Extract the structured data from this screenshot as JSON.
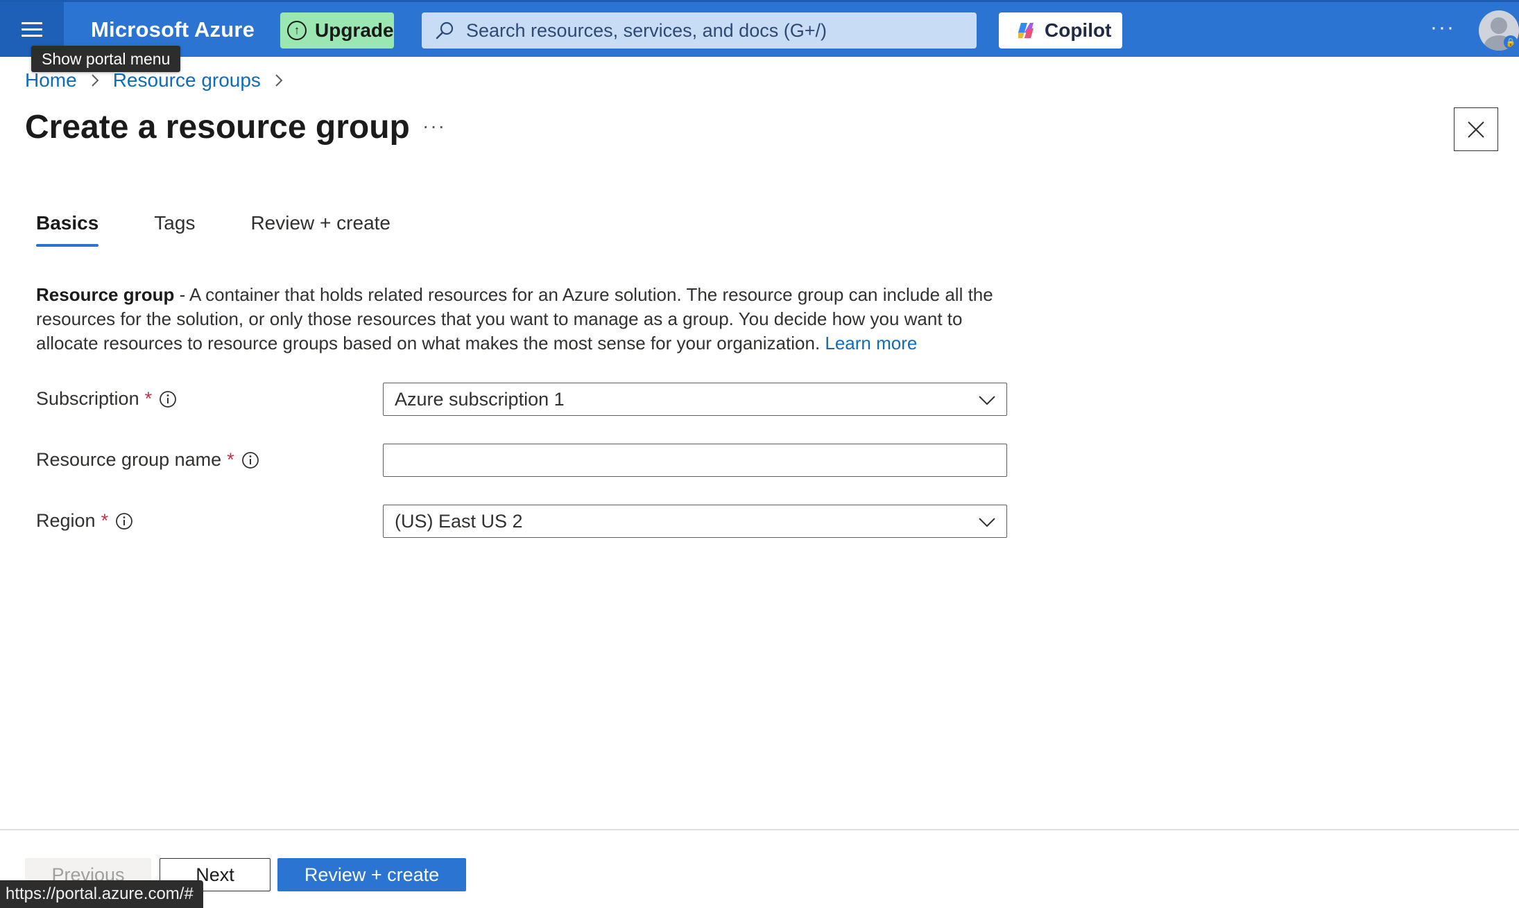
{
  "topbar": {
    "brand": "Microsoft Azure",
    "upgrade_label": "Upgrade",
    "search_placeholder": "Search resources, services, and docs (G+/)",
    "copilot_label": "Copilot",
    "more_label": "···"
  },
  "tooltip": {
    "text": "Show portal menu"
  },
  "breadcrumb": {
    "items": [
      {
        "label": "Home"
      },
      {
        "label": "Resource groups"
      }
    ]
  },
  "page": {
    "title": "Create a resource group",
    "more_label": "···"
  },
  "tabs": [
    {
      "label": "Basics",
      "active": true
    },
    {
      "label": "Tags",
      "active": false
    },
    {
      "label": "Review + create",
      "active": false
    }
  ],
  "description": {
    "term": "Resource group",
    "text": " - A container that holds related resources for an Azure solution. The resource group can include all the resources for the solution, or only those resources that you want to manage as a group. You decide how you want to allocate resources to resource groups based on what makes the most sense for your organization. ",
    "link": "Learn more"
  },
  "form": {
    "subscription": {
      "label": "Subscription",
      "required": "*",
      "value": "Azure subscription 1"
    },
    "resource_group_name": {
      "label": "Resource group name",
      "required": "*",
      "value": ""
    },
    "region": {
      "label": "Region",
      "required": "*",
      "value": "(US) East US 2"
    }
  },
  "footer": {
    "previous_label": "Previous",
    "next_label": "Next",
    "review_label": "Review + create"
  },
  "status_bar": {
    "url": "https://portal.azure.com/#"
  },
  "colors": {
    "topbar": "#2b74d1",
    "accent": "#2b74d1",
    "link": "#0f6cbd",
    "required": "#c4314b",
    "upgrade_bg": "#9be7b2"
  }
}
